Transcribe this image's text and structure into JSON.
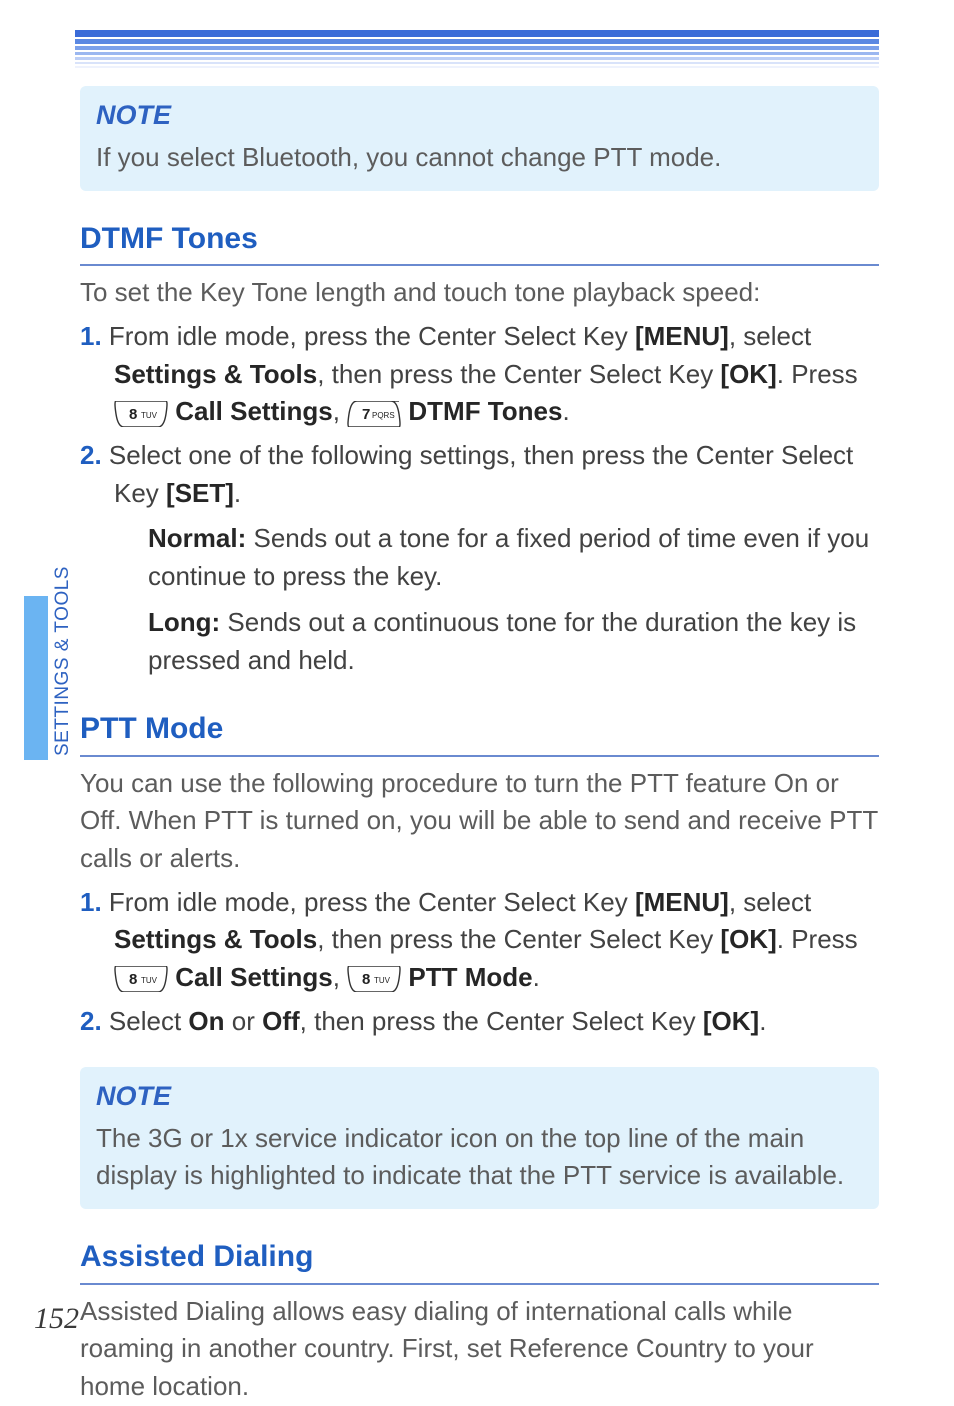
{
  "page_number": "152",
  "sidebar_label": "SETTINGS & TOOLS",
  "note1": {
    "title": "NOTE",
    "text": "If you select Bluetooth, you cannot change PTT mode."
  },
  "dtmf": {
    "heading": "DTMF Tones",
    "intro": "To set the Key Tone length and touch tone playback speed:",
    "step1_a": "From idle mode, press the Center Select Key ",
    "step1_menu": "[MENU]",
    "step1_b": ", select ",
    "step1_settings": "Settings & Tools",
    "step1_c": ", then press the Center Select Key ",
    "step1_ok": "[OK]",
    "step1_d": ". Press ",
    "step1_call": " Call Settings",
    "step1_e": ", ",
    "step1_tones": " DTMF Tones",
    "step1_f": ".",
    "step2_a": "Select one of the following settings, then press the Center Select Key ",
    "step2_set": "[SET]",
    "step2_b": ".",
    "normal_label": "Normal:",
    "normal_text": " Sends out a tone for a fixed period of time even if you continue to press the key.",
    "long_label": "Long:",
    "long_text": " Sends out a continuous tone for the duration the key is pressed and held."
  },
  "ptt": {
    "heading": "PTT Mode",
    "intro": "You can use the following procedure to turn the PTT feature On or Off. When PTT is turned on, you will be able to send and receive PTT calls or alerts.",
    "step1_a": "From idle mode, press the Center Select Key ",
    "step1_menu": "[MENU]",
    "step1_b": ", select ",
    "step1_settings": "Settings & Tools",
    "step1_c": ", then press the Center Select Key ",
    "step1_ok": "[OK]",
    "step1_d": ". Press ",
    "step1_call": " Call Settings",
    "step1_e": ", ",
    "step1_mode": " PTT Mode",
    "step1_f": ".",
    "step2_a": "Select ",
    "step2_on": "On",
    "step2_b": " or ",
    "step2_off": "Off",
    "step2_c": ", then press the Center Select Key ",
    "step2_ok": "[OK]",
    "step2_d": "."
  },
  "note2": {
    "title": "NOTE",
    "text": "The 3G or 1x service indicator icon on the top line of the main display is highlighted to indicate that the PTT service is available."
  },
  "assisted": {
    "heading": "Assisted Dialing",
    "intro": "Assisted Dialing allows easy dialing of international calls while roaming in another country. First, set Reference Country to your home location."
  },
  "keys": {
    "k8": {
      "digit": "8",
      "letters": "TUV"
    },
    "k7": {
      "digit": "7",
      "letters": "PQRS"
    }
  }
}
